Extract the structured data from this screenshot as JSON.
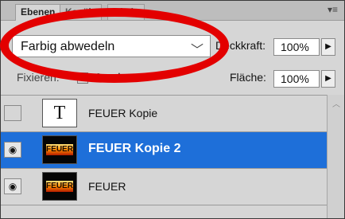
{
  "tabs": [
    {
      "label": "Ebenen",
      "active": true
    },
    {
      "label": "Kanäle",
      "active": false
    },
    {
      "label": "Pfade",
      "active": false
    }
  ],
  "menu_icon": "panel-menu-icon",
  "blend_mode": {
    "value": "Farbig abwedeln"
  },
  "opacity": {
    "label": "Deckkraft:",
    "value": "100%"
  },
  "lock": {
    "label": "Fixieren:",
    "icons": [
      "lock-transparent-pixels-icon",
      "lock-image-pixels-icon",
      "lock-position-icon",
      "lock-all-icon"
    ]
  },
  "fill": {
    "label": "Fläche:",
    "value": "100%"
  },
  "layers": [
    {
      "name": "FEUER Kopie",
      "type": "text",
      "visible": false,
      "selected": false,
      "thumb_text": "T"
    },
    {
      "name": "FEUER Kopie 2",
      "type": "image",
      "visible": true,
      "selected": true,
      "thumb_text": "FEUER"
    },
    {
      "name": "FEUER",
      "type": "image",
      "visible": true,
      "selected": false,
      "thumb_text": "FEUER"
    }
  ],
  "colors": {
    "selection": "#1e6fd9",
    "annotation": "#e30000"
  }
}
